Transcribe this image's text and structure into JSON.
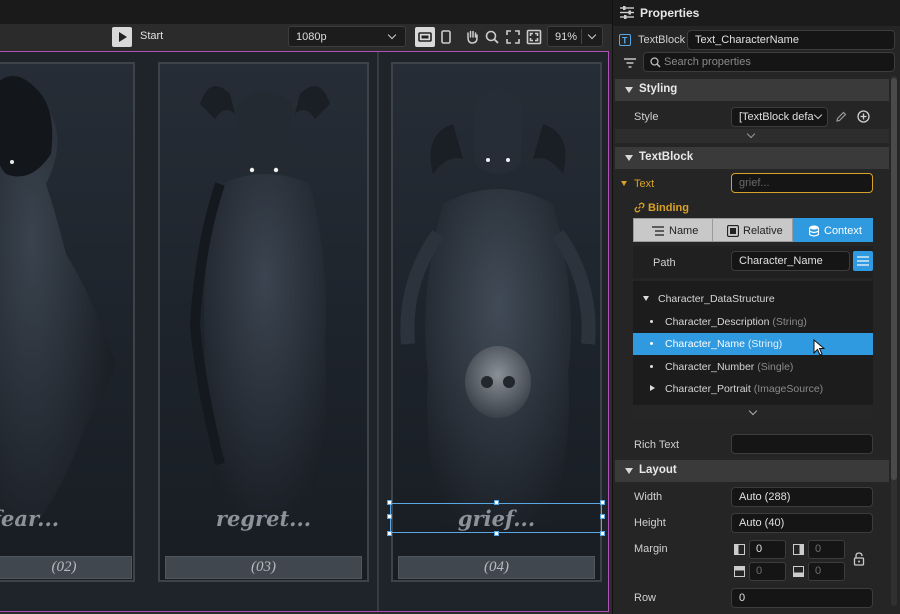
{
  "toolbar": {
    "start_label": "Start",
    "resolution": "1080p",
    "zoom": "91%"
  },
  "canvas": {
    "panels": [
      {
        "caption": "fear...",
        "number": "(02)"
      },
      {
        "caption": "regret...",
        "number": "(03)"
      },
      {
        "caption": "grief...",
        "number": "(04)"
      }
    ]
  },
  "properties": {
    "title": "Properties",
    "type_label": "TextBlock",
    "element_name": "Text_CharacterName",
    "search_placeholder": "Search properties",
    "styling": {
      "header": "Styling",
      "style_label": "Style",
      "style_value": "[TextBlock defa"
    },
    "textblock": {
      "header": "TextBlock",
      "text_label": "Text",
      "text_placeholder": "grief...",
      "binding_label": "Binding",
      "modes": [
        "Name",
        "Relative",
        "Context"
      ],
      "active_mode": "Context",
      "path_label": "Path",
      "path_value": "Character_Name",
      "tree": [
        {
          "name": "Character_DataStructure",
          "type": ""
        },
        {
          "name": "Character_Description",
          "type": "(String)"
        },
        {
          "name": "Character_Name",
          "type": "(String)"
        },
        {
          "name": "Character_Number",
          "type": "(Single)"
        },
        {
          "name": "Character_Portrait",
          "type": "(ImageSource)"
        }
      ],
      "rich_text_label": "Rich Text",
      "rich_text_value": ""
    },
    "layout": {
      "header": "Layout",
      "width_label": "Width",
      "width_value": "Auto (288)",
      "height_label": "Height",
      "height_value": "Auto (40)",
      "margin_label": "Margin",
      "margin_left": "0",
      "margin_right": "0",
      "margin_top": "0",
      "margin_bottom": "0",
      "row_label": "Row",
      "row_value": "0"
    }
  },
  "colors": {
    "accent": "#2f9ae0",
    "selection_outline": "#5aa7e6",
    "stage_border": "#b04fb6",
    "text_field_border": "#d8a12a"
  }
}
